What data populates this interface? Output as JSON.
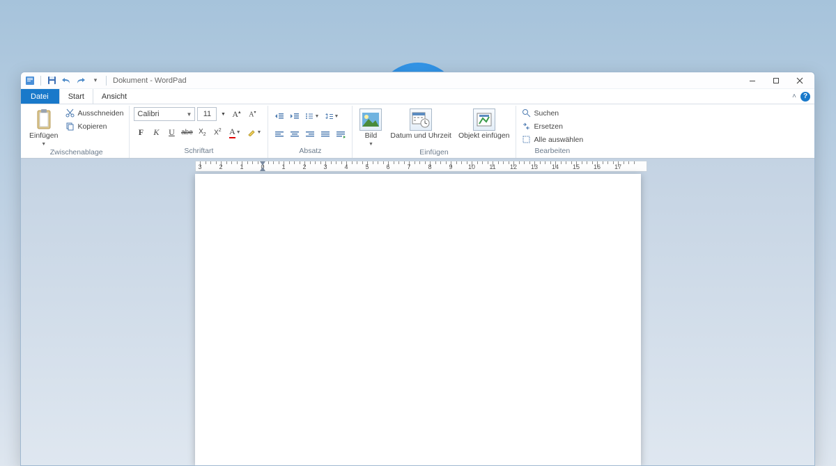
{
  "title": "Dokument - WordPad",
  "tabs": {
    "file": "Datei",
    "home": "Start",
    "view": "Ansicht"
  },
  "clipboard": {
    "paste": "Einfügen",
    "cut": "Ausschneiden",
    "copy": "Kopieren",
    "group": "Zwischenablage"
  },
  "font": {
    "name": "Calibri",
    "size": "11",
    "group": "Schriftart"
  },
  "paragraph": {
    "group": "Absatz"
  },
  "insert": {
    "picture": "Bild",
    "datetime": "Datum und Uhrzeit",
    "object": "Objekt einfügen",
    "group": "Einfügen"
  },
  "editing": {
    "find": "Suchen",
    "replace": "Ersetzen",
    "selectall": "Alle auswählen",
    "group": "Bearbeiten"
  },
  "ruler": {
    "start": -3,
    "end": 17
  }
}
